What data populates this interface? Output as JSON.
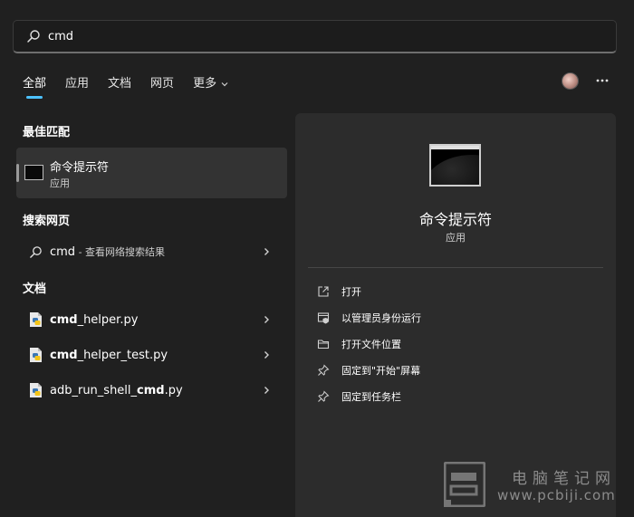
{
  "search": {
    "value": "cmd",
    "icon": "search-icon"
  },
  "tabs": [
    {
      "label": "全部",
      "active": true
    },
    {
      "label": "应用"
    },
    {
      "label": "文档"
    },
    {
      "label": "网页"
    },
    {
      "label": "更多"
    }
  ],
  "sections": {
    "best_match": "最佳匹配",
    "web": "搜索网页",
    "documents": "文档"
  },
  "best_match": {
    "name": "命令提示符",
    "type": "应用"
  },
  "web_result": {
    "query": "cmd",
    "suffix": " - 查看网络搜索结果"
  },
  "documents": [
    {
      "bold": "cmd",
      "rest": "_helper.py"
    },
    {
      "bold": "cmd",
      "rest": "_helper_test.py"
    },
    {
      "prefix": "adb_run_shell_",
      "bold": "cmd",
      "rest": ".py"
    }
  ],
  "panel": {
    "title": "命令提示符",
    "subtitle": "应用",
    "actions": [
      {
        "label": "打开",
        "icon": "open-external-icon"
      },
      {
        "label": "以管理员身份运行",
        "icon": "shield-admin-icon"
      },
      {
        "label": "打开文件位置",
        "icon": "folder-icon"
      },
      {
        "label": "固定到\"开始\"屏幕",
        "icon": "pin-icon"
      },
      {
        "label": "固定到任务栏",
        "icon": "pin-icon"
      }
    ]
  },
  "watermark": {
    "title": "电脑笔记网",
    "url": "www.pcbiji.com"
  },
  "colors": {
    "accent": "#4cc2ff",
    "background": "#202020",
    "panel": "#2c2c2c"
  }
}
